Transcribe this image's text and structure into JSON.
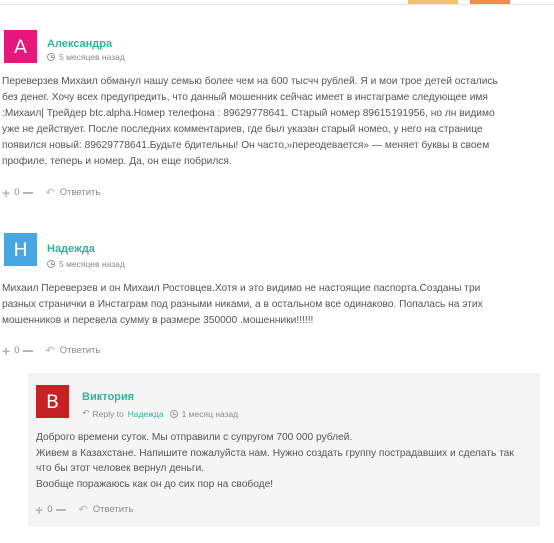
{
  "colors": {
    "author": "#2fb49a",
    "avatar_a": "#e8177c",
    "avatar_h": "#4aa6e0",
    "avatar_b": "#c62226",
    "reply_bg": "#f5f5f5"
  },
  "comments": [
    {
      "avatar_letter": "A",
      "author": "Александра",
      "time": "5 месяцев назад",
      "text_lines": [
        "Переверзев Михаил обманул нашу семью более чем на 600 тысчч рублей. Я и мои трое детей остались",
        "без денег. Хочу всех предупредить, что данный мошенник сейчас имеет в инстаграме следующее имя",
        ":Михаил| Трейдер btc.alpha.Номер телефона : 89629778641. Старый номер 89615191956, но лн видимо",
        "уже не действует. После последних комментариев, где был указан старый номео, у него на странице",
        "появился новый: 89629778641.Будьте бдительны! Он часто,»переодевается» — меняет буквы в своем",
        "профиле, теперь и номер. Да, он еще побрился."
      ],
      "votes": "0",
      "reply_label": "Ответить"
    },
    {
      "avatar_letter": "Н",
      "author": "Надежда",
      "time": "5 месяцев назад",
      "text_lines": [
        "Михаил Переверзев и он Михаил Ростовцев.Хотя и это видимо не настоящие паспорта.Созданы три",
        "разных странички в Инстаграм под разными никами, а в остальном все одинаково. Попалась на этих",
        "мошенников и перевела сумму в размере 350000 .мошенники!!!!!!"
      ],
      "votes": "0",
      "reply_label": "Ответить"
    },
    {
      "avatar_letter": "В",
      "author": "Виктория",
      "reply_to_label": "Reply to",
      "reply_to_name": "Надежда",
      "time": "1 месяц назад",
      "text_lines": [
        "Доброго времени суток. Мы отправили с супругом 700 000 рублей.",
        "Живем в Казахстане. Напишите пожалуйста нам. Нужно создать группу пострадавших и сделать так",
        "что бы этот человек вернул деньги.",
        "Вообще поражаюсь как он до сих пор на свободе!"
      ],
      "votes": "0",
      "reply_label": "Ответить"
    }
  ]
}
